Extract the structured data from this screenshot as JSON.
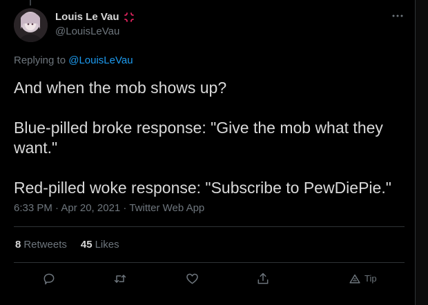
{
  "tweet": {
    "author": {
      "display_name": "Louis Le Vau",
      "handle": "@LouisLeVau",
      "badge_icon": "anger-symbol-icon"
    },
    "replying_prefix": "Replying to ",
    "replying_to": "@LouisLeVau",
    "paragraphs": [
      "And when the mob shows up?",
      "Blue-pilled broke response: \"Give the mob what they want.\"",
      "Red-pilled woke response: \"Subscribe to PewDiePie.\""
    ],
    "timestamp": "6:33 PM · Apr 20, 2021 · Twitter Web App",
    "stats": {
      "retweets_count": "8",
      "retweets_label": "Retweets",
      "likes_count": "45",
      "likes_label": "Likes"
    },
    "actions": {
      "tip_label": "Tip"
    }
  },
  "colors": {
    "background": "#000000",
    "text_primary": "#d9d9d9",
    "text_secondary": "#6e767d",
    "link": "#1d9bf0",
    "divider": "#2f3336",
    "badge": "#e0245e"
  }
}
